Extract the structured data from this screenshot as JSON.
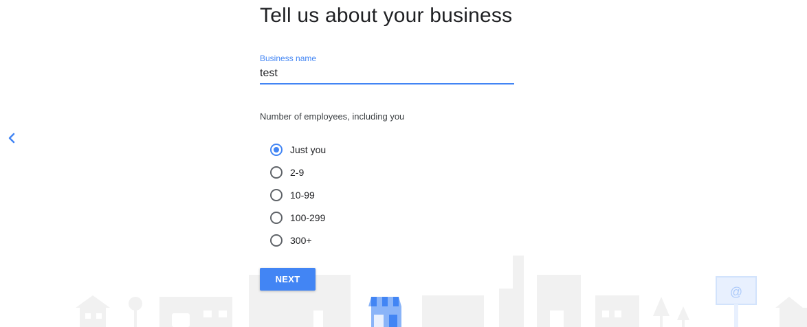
{
  "page": {
    "title": "Tell us about your business"
  },
  "business_name": {
    "label": "Business name",
    "value": "test"
  },
  "employees": {
    "label": "Number of employees, including you",
    "selected": "Just you",
    "options": [
      "Just you",
      "2-9",
      "10-99",
      "100-299",
      "300+"
    ]
  },
  "actions": {
    "next_label": "NEXT",
    "back_icon": "chevron-left-icon"
  },
  "colors": {
    "accent": "#4285f4",
    "text": "#202124",
    "skyline": "#eeeeee"
  }
}
